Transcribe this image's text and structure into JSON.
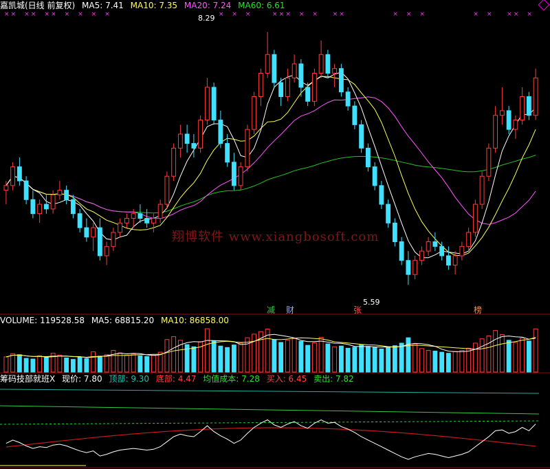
{
  "price_header": {
    "title": "嘉凯城(日线 前复权)",
    "ma5_label": "MA5: 7.41",
    "ma10_label": "MA10: 7.35",
    "ma20_label": "MA20: 7.24",
    "ma60_label": "MA60: 6.61"
  },
  "volume_header": {
    "volume_label": "VOLUME: 119528.58",
    "ma5_label": "MA5: 68815.20",
    "ma10_label": "MA10: 86858.00"
  },
  "chip_header": {
    "title": "筹码技部就班X",
    "price_label": "现价: 7.80",
    "top_label": "顶部: 9.30",
    "bottom_label": "底部: 4.47",
    "avg_cost_label": "均值成本: 7.28",
    "buy_label": "买入: 6.45",
    "sell_label": "卖出: 7.82"
  },
  "annotations": {
    "high_label": "8.29",
    "low_label": "5.59",
    "event_tags": [
      "减",
      "财",
      "张",
      "榜"
    ]
  },
  "watermark": "翔博软件 www.xiangbosoft.com",
  "colors": {
    "up": "#ff3c3c",
    "down": "#40e0ff",
    "ma5": "#ffffff",
    "ma10": "#ffff55",
    "ma20": "#ff55ff",
    "ma60": "#22c322",
    "chip_top": "#20b0a0",
    "chip_bottom": "#c81818"
  },
  "chart_data": [
    {
      "type": "candlestick",
      "title": "嘉凯城(日线 前复权)",
      "ylim": [
        5.4,
        8.5
      ],
      "annotated_high": 8.29,
      "annotated_low": 5.59,
      "ohlc": [
        [
          6.6,
          6.7,
          6.45,
          6.65
        ],
        [
          6.65,
          6.9,
          6.6,
          6.85
        ],
        [
          6.85,
          6.95,
          6.65,
          6.7
        ],
        [
          6.7,
          6.75,
          6.45,
          6.5
        ],
        [
          6.5,
          6.6,
          6.3,
          6.35
        ],
        [
          6.35,
          6.5,
          6.25,
          6.45
        ],
        [
          6.45,
          6.55,
          6.35,
          6.4
        ],
        [
          6.4,
          6.6,
          6.35,
          6.55
        ],
        [
          6.55,
          6.7,
          6.5,
          6.6
        ],
        [
          6.6,
          6.65,
          6.45,
          6.5
        ],
        [
          6.5,
          6.55,
          6.3,
          6.35
        ],
        [
          6.35,
          6.4,
          6.15,
          6.2
        ],
        [
          6.2,
          6.3,
          6.05,
          6.1
        ],
        [
          6.1,
          6.25,
          5.95,
          6.2
        ],
        [
          6.2,
          6.3,
          5.85,
          5.9
        ],
        [
          5.9,
          6.05,
          5.8,
          6.0
        ],
        [
          6.0,
          6.2,
          5.95,
          6.15
        ],
        [
          6.15,
          6.3,
          6.1,
          6.25
        ],
        [
          6.25,
          6.35,
          6.2,
          6.3
        ],
        [
          6.3,
          6.4,
          6.2,
          6.35
        ],
        [
          6.35,
          6.45,
          6.25,
          6.3
        ],
        [
          6.3,
          6.4,
          6.2,
          6.25
        ],
        [
          6.25,
          6.35,
          6.15,
          6.3
        ],
        [
          6.3,
          6.5,
          6.25,
          6.45
        ],
        [
          6.45,
          6.8,
          6.4,
          6.75
        ],
        [
          6.75,
          7.1,
          6.7,
          7.05
        ],
        [
          7.05,
          7.3,
          6.95,
          7.2
        ],
        [
          7.2,
          7.3,
          7.0,
          7.1
        ],
        [
          7.1,
          7.2,
          6.95,
          7.05
        ],
        [
          7.05,
          7.4,
          7.0,
          7.35
        ],
        [
          7.35,
          7.8,
          7.3,
          7.7
        ],
        [
          7.7,
          7.75,
          7.3,
          7.35
        ],
        [
          7.35,
          7.45,
          7.05,
          7.1
        ],
        [
          7.1,
          7.2,
          6.85,
          6.9
        ],
        [
          6.9,
          7.0,
          6.6,
          6.65
        ],
        [
          6.65,
          6.9,
          6.6,
          6.85
        ],
        [
          6.85,
          7.3,
          6.8,
          7.25
        ],
        [
          7.25,
          7.65,
          7.2,
          7.6
        ],
        [
          7.6,
          7.9,
          7.5,
          7.85
        ],
        [
          7.85,
          8.29,
          7.8,
          8.05
        ],
        [
          8.05,
          8.1,
          7.7,
          7.75
        ],
        [
          7.75,
          7.8,
          7.5,
          7.6
        ],
        [
          7.6,
          7.9,
          7.55,
          7.8
        ],
        [
          7.8,
          8.05,
          7.75,
          7.95
        ],
        [
          7.95,
          8.0,
          7.6,
          7.7
        ],
        [
          7.7,
          7.75,
          7.5,
          7.55
        ],
        [
          7.55,
          7.9,
          7.5,
          7.85
        ],
        [
          7.85,
          8.2,
          7.8,
          8.05
        ],
        [
          8.05,
          8.1,
          7.8,
          7.85
        ],
        [
          7.85,
          7.95,
          7.7,
          7.9
        ],
        [
          7.9,
          7.95,
          7.6,
          7.65
        ],
        [
          7.65,
          7.7,
          7.45,
          7.5
        ],
        [
          7.5,
          7.55,
          7.25,
          7.3
        ],
        [
          7.3,
          7.35,
          7.0,
          7.05
        ],
        [
          7.05,
          7.1,
          6.8,
          6.85
        ],
        [
          6.85,
          6.9,
          6.6,
          6.65
        ],
        [
          6.65,
          6.7,
          6.4,
          6.45
        ],
        [
          6.45,
          6.5,
          6.2,
          6.25
        ],
        [
          6.25,
          6.3,
          6.0,
          6.05
        ],
        [
          6.05,
          6.1,
          5.8,
          5.85
        ],
        [
          5.85,
          5.95,
          5.59,
          5.7
        ],
        [
          5.7,
          5.9,
          5.65,
          5.85
        ],
        [
          5.85,
          6.0,
          5.8,
          5.95
        ],
        [
          5.95,
          6.1,
          5.9,
          6.05
        ],
        [
          6.05,
          6.15,
          5.95,
          6.0
        ],
        [
          6.0,
          6.05,
          5.85,
          5.9
        ],
        [
          5.9,
          6.0,
          5.75,
          5.8
        ],
        [
          5.8,
          5.95,
          5.7,
          5.9
        ],
        [
          5.9,
          6.05,
          5.85,
          6.0
        ],
        [
          6.0,
          6.2,
          5.95,
          6.15
        ],
        [
          6.15,
          6.5,
          6.1,
          6.45
        ],
        [
          6.45,
          6.8,
          6.4,
          6.75
        ],
        [
          6.75,
          7.1,
          6.7,
          7.05
        ],
        [
          7.05,
          7.5,
          7.0,
          7.4
        ],
        [
          7.4,
          7.7,
          7.3,
          7.45
        ],
        [
          7.45,
          7.5,
          7.2,
          7.25
        ],
        [
          7.25,
          7.4,
          7.15,
          7.35
        ],
        [
          7.35,
          7.7,
          7.3,
          7.6
        ],
        [
          7.6,
          7.65,
          7.35,
          7.4
        ],
        [
          7.4,
          7.9,
          7.35,
          7.8
        ]
      ],
      "series": [
        {
          "name": "MA5",
          "last": 7.41
        },
        {
          "name": "MA10",
          "last": 7.35
        },
        {
          "name": "MA20",
          "last": 7.24
        },
        {
          "name": "MA60",
          "last": 6.61
        }
      ]
    },
    {
      "type": "bar",
      "title": "VOLUME",
      "last_volume": 119528.58,
      "ma5": 68815.2,
      "ma10": 86858.0,
      "values": [
        42000,
        51000,
        48000,
        38000,
        36000,
        45000,
        40000,
        52000,
        47000,
        39000,
        35000,
        41000,
        37000,
        56000,
        44000,
        48000,
        60000,
        53000,
        47000,
        50000,
        45000,
        43000,
        46000,
        55000,
        90000,
        98000,
        88000,
        76000,
        70000,
        84000,
        120000,
        86000,
        72000,
        68000,
        75000,
        80000,
        95000,
        105000,
        112000,
        119000,
        90000,
        82000,
        88000,
        93000,
        85000,
        74000,
        81000,
        96000,
        78000,
        70000,
        72000,
        66000,
        69000,
        75000,
        71000,
        68000,
        64000,
        70000,
        73000,
        80000,
        95000,
        78000,
        65000,
        60000,
        58000,
        55000,
        52000,
        57000,
        60000,
        66000,
        80000,
        92000,
        100000,
        115000,
        104000,
        88000,
        82000,
        94000,
        86000,
        119528.58
      ]
    },
    {
      "type": "line",
      "title": "筹码技部就班X",
      "current": 7.8,
      "top": 9.3,
      "bottom": 4.47,
      "avg_cost": 7.28,
      "buy": 6.45,
      "sell": 7.82
    }
  ]
}
